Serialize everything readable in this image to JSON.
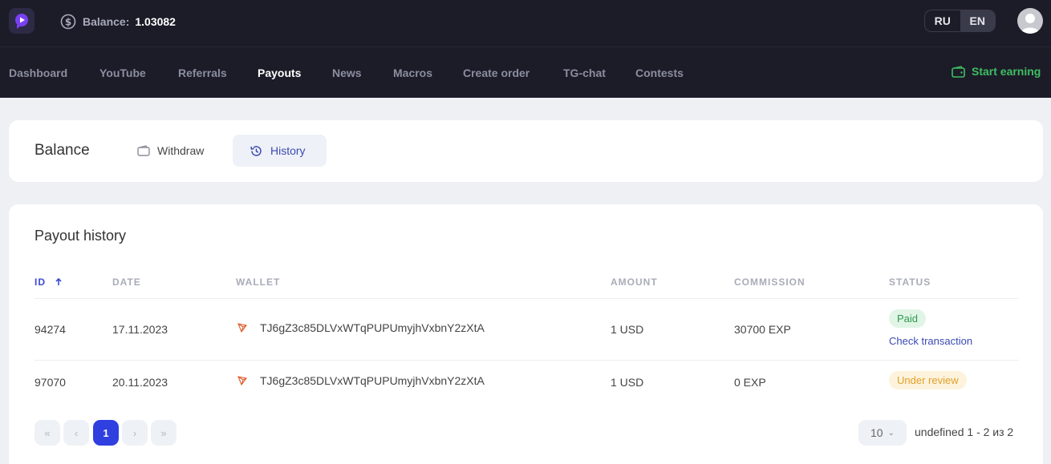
{
  "header": {
    "balance_label": "Balance:",
    "balance_value": "1.03082",
    "lang": [
      "RU",
      "EN"
    ],
    "active_lang": "EN"
  },
  "nav": {
    "items": [
      "Dashboard",
      "YouTube",
      "Referrals",
      "Payouts",
      "News",
      "Macros",
      "Create order",
      "TG-chat",
      "Contests"
    ],
    "active": "Payouts",
    "start_earning": "Start earning"
  },
  "balance_card": {
    "title": "Balance",
    "tabs": [
      "Withdraw",
      "History"
    ],
    "active_tab": "History"
  },
  "history": {
    "title": "Payout history",
    "columns": [
      "ID",
      "DATE",
      "WALLET",
      "AMOUNT",
      "COMMISSION",
      "STATUS"
    ],
    "rows": [
      {
        "id": "94274",
        "date": "17.11.2023",
        "wallet": "TJ6gZ3c85DLVxWTqPUPUmyjhVxbnY2zXtA",
        "amount": "1 USD",
        "commission": "30700 EXP",
        "status": "Paid",
        "link": "Check transaction"
      },
      {
        "id": "97070",
        "date": "20.11.2023",
        "wallet": "TJ6gZ3c85DLVxWTqPUPUmyjhVxbnY2zXtA",
        "amount": "1 USD",
        "commission": "0 EXP",
        "status": "Under review"
      }
    ],
    "pagination": {
      "first": "«",
      "prev": "‹",
      "current": "1",
      "next": "›",
      "last": "»",
      "per_page": "10",
      "range_text": "undefined 1 - 2 из 2"
    }
  },
  "colors": {
    "accent": "#2f3fe0",
    "success": "#3fbf63",
    "topbar": "#1c1c28"
  }
}
